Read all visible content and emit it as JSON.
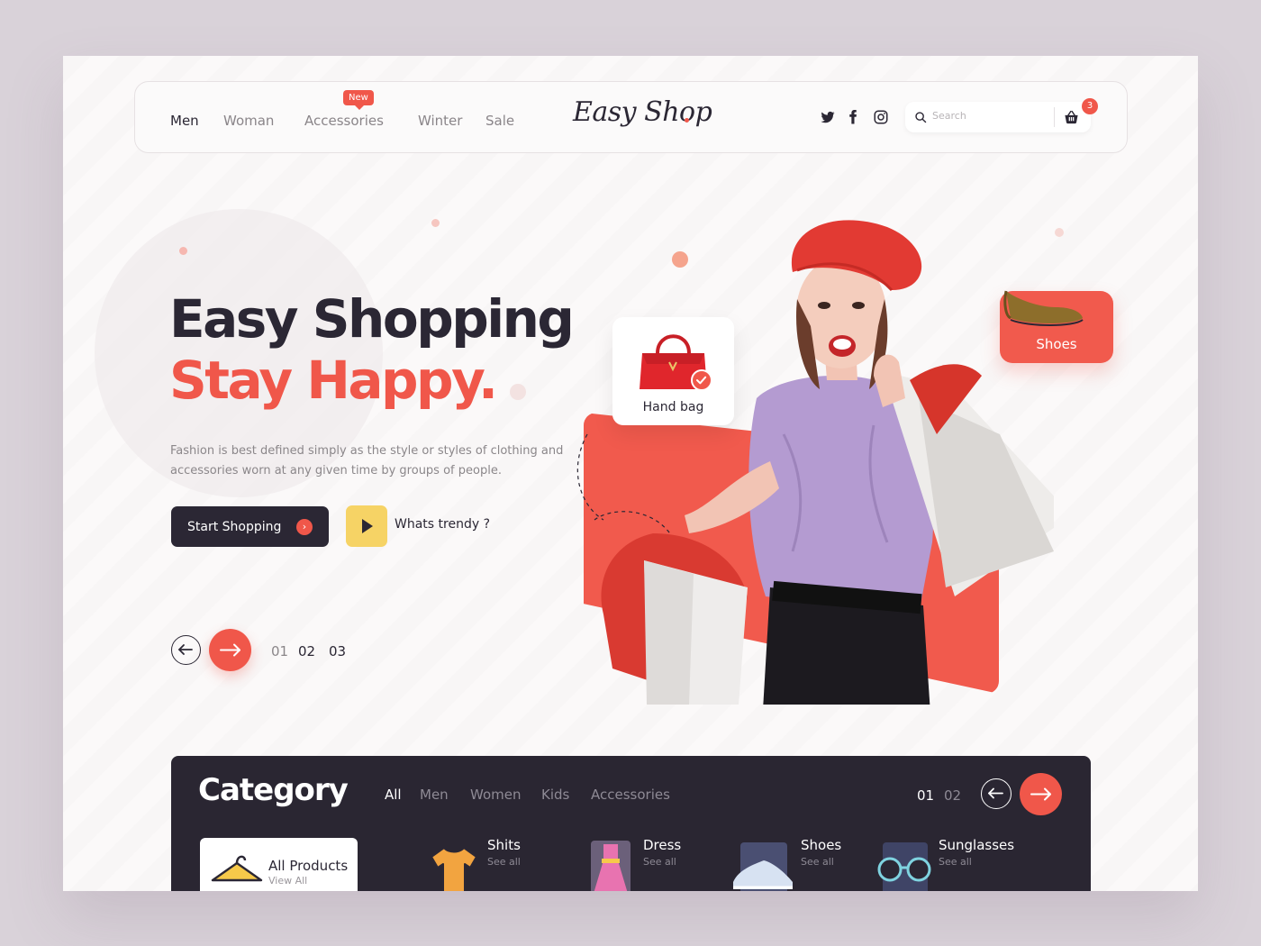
{
  "nav": {
    "links": [
      "Men",
      "Woman",
      "Accessories",
      "Winter",
      "Sale"
    ],
    "new_badge": "New",
    "logo": "Easy Shop",
    "search_placeholder": "Search",
    "cart_count": "3"
  },
  "hero": {
    "title_line1": "Easy Shopping",
    "title_line2": "Stay Happy.",
    "description": "Fashion is best defined simply as the style or styles of clothing and accessories worn at any given time by groups of people.",
    "primary_button": "Start Shopping",
    "secondary_label": "Whats trendy ?",
    "pages": [
      "01",
      "02",
      "03"
    ],
    "cards": {
      "handbag": "Hand bag",
      "shoes": "Shoes"
    }
  },
  "category": {
    "title": "Category",
    "tabs": [
      "All",
      "Men",
      "Women",
      "Kids",
      "Accessories"
    ],
    "pages": [
      "01",
      "02"
    ],
    "items": [
      {
        "name": "All Products",
        "sub": "View All"
      },
      {
        "name": "Shits",
        "sub": "See all"
      },
      {
        "name": "Dress",
        "sub": "See all"
      },
      {
        "name": "Shoes",
        "sub": "See all"
      },
      {
        "name": "Sunglasses",
        "sub": "See all"
      }
    ]
  },
  "colors": {
    "accent": "#f0574a",
    "dark": "#2b2734",
    "yellow": "#f6d365"
  }
}
